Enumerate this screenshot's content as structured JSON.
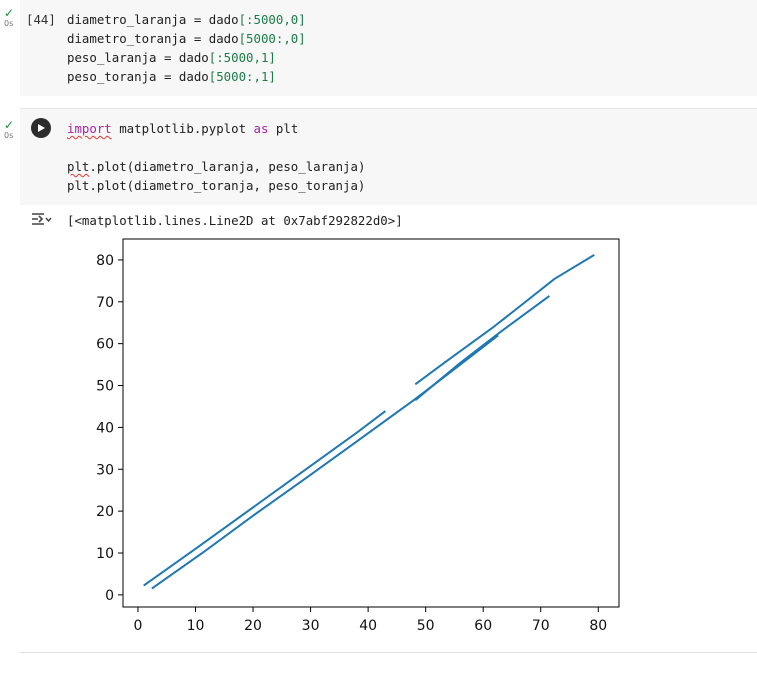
{
  "cell1": {
    "status": {
      "check": "✓",
      "time": "0s"
    },
    "execution_count": "[44]",
    "lines": [
      [
        {
          "t": "diametro_laranja = dado",
          "c": ""
        },
        {
          "t": "[:5000,0]",
          "c": "#1e7b4b"
        }
      ],
      [
        {
          "t": "diametro_toranja = dado",
          "c": ""
        },
        {
          "t": "[5000:,0]",
          "c": "#1e7b4b"
        }
      ],
      [
        {
          "t": "peso_laranja = dado",
          "c": ""
        },
        {
          "t": "[:5000,1]",
          "c": "#1e7b4b"
        }
      ],
      [
        {
          "t": "peso_toranja = dado",
          "c": ""
        },
        {
          "t": "[5000:,1]",
          "c": "#1e7b4b"
        }
      ]
    ]
  },
  "cell2": {
    "status": {
      "check": "✓",
      "time": "0s"
    },
    "run_icon": "play-icon",
    "line1": {
      "import": "import",
      "module": " matplotlib.pyplot ",
      "as": "as",
      "alias": " plt"
    },
    "line2": {
      "plt": "plt",
      "rest": ".plot(diametro_laranja, peso_laranja)"
    },
    "line3": "plt.plot(diametro_toranja, peso_toranja)"
  },
  "output": {
    "icon": "output-toggle-icon",
    "text": "[<matplotlib.lines.Line2D at 0x7abf292822d0>]"
  },
  "chart_data": {
    "type": "line",
    "title": "",
    "xlabel": "",
    "ylabel": "",
    "xlim": [
      -2.6,
      83.6
    ],
    "ylim": [
      -2.9,
      85.0
    ],
    "x_ticks": [
      0,
      10,
      20,
      30,
      40,
      50,
      60,
      70,
      80
    ],
    "y_ticks": [
      0,
      10,
      20,
      30,
      40,
      50,
      60,
      70,
      80
    ],
    "color": "#1f77b4",
    "series": [
      {
        "x": [
          2.4,
          11.5,
          20.4,
          29.6,
          38.7,
          48.0,
          54.8,
          62.6
        ],
        "y": [
          1.5,
          10.3,
          19.3,
          28.3,
          37.3,
          46.6,
          53.7,
          62.0
        ]
      },
      {
        "x": [
          48.2,
          56.0,
          62.8,
          71.5
        ],
        "y": [
          46.5,
          55.4,
          62.6,
          71.4
        ]
      },
      {
        "x": [
          48.2,
          52.4,
          57.5,
          61.8,
          66.9,
          72.4,
          79.3
        ],
        "y": [
          50.3,
          54.6,
          59.7,
          64.0,
          69.5,
          75.5,
          81.2
        ]
      },
      {
        "x": [
          1.0,
          10.0,
          20.0,
          30.0,
          38.0,
          43.0
        ],
        "y": [
          2.2,
          11.0,
          20.9,
          30.8,
          38.7,
          43.9
        ]
      }
    ]
  }
}
